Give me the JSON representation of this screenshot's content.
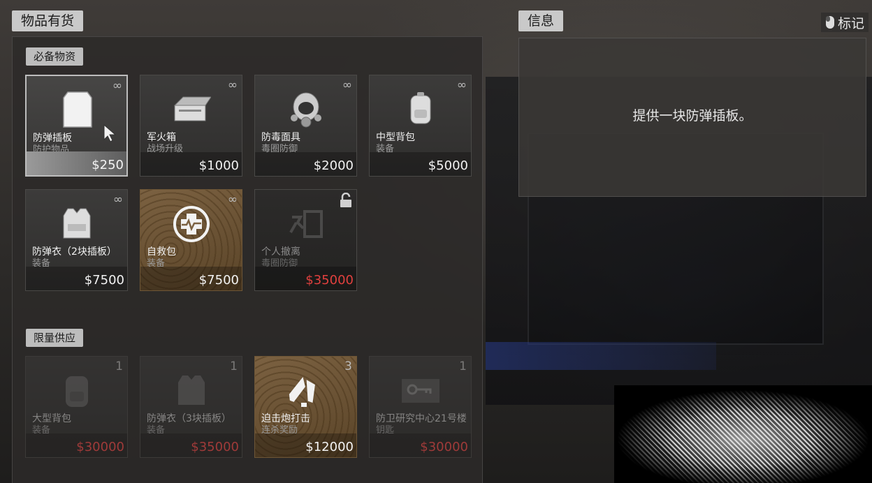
{
  "header": {
    "available_label": "物品有货",
    "info_label": "信息",
    "mark_label": "标记"
  },
  "sections": {
    "essentials_label": "必备物资",
    "limited_label": "限量供应"
  },
  "essentials": [
    {
      "name": "防弹插板",
      "sub": "防护物品",
      "price": "$250",
      "badge": "∞",
      "icon": "armor-plate-icon"
    },
    {
      "name": "军火箱",
      "sub": "战场升级",
      "price": "$1000",
      "badge": "∞",
      "icon": "ammo-box-icon"
    },
    {
      "name": "防毒面具",
      "sub": "毒圈防御",
      "price": "$2000",
      "badge": "∞",
      "icon": "gas-mask-icon"
    },
    {
      "name": "中型背包",
      "sub": "装备",
      "price": "$5000",
      "badge": "∞",
      "icon": "backpack-icon"
    },
    {
      "name": "防弹衣（2块插板）",
      "sub": "装备",
      "price": "$7500",
      "badge": "∞",
      "icon": "armor-vest-icon"
    },
    {
      "name": "自救包",
      "sub": "装备",
      "price": "$7500",
      "badge": "∞",
      "icon": "self-revive-icon"
    },
    {
      "name": "个人撤离",
      "sub": "毒圈防御",
      "price": "$35000",
      "badge": "lock",
      "icon": "personal-exfil-icon"
    }
  ],
  "limited": [
    {
      "name": "大型背包",
      "sub": "装备",
      "price": "$30000",
      "badge": "1",
      "icon": "large-backpack-icon"
    },
    {
      "name": "防弹衣（3块插板）",
      "sub": "装备",
      "price": "$35000",
      "badge": "1",
      "icon": "armor-vest-icon"
    },
    {
      "name": "迫击炮打击",
      "sub": "连杀奖励",
      "price": "$12000",
      "badge": "3",
      "icon": "mortar-icon"
    },
    {
      "name": "防卫研究中心21号楼",
      "sub": "钥匙",
      "price": "$30000",
      "badge": "1",
      "icon": "key-icon"
    }
  ],
  "info": {
    "description": "提供一块防弹插板。"
  },
  "colors": {
    "price_unaffordable": "#e0403e",
    "tan_card": "#7b6141"
  }
}
